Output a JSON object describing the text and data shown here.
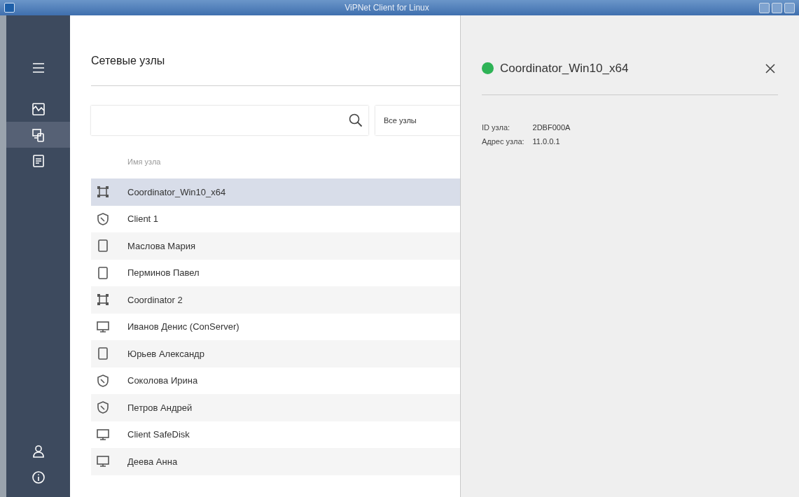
{
  "window": {
    "title": "ViPNet Client for Linux"
  },
  "sidebar": {
    "items": [
      {
        "kind": "map",
        "selected": false
      },
      {
        "kind": "nodes",
        "selected": true
      },
      {
        "kind": "log",
        "selected": false
      }
    ],
    "bottom": [
      {
        "kind": "user"
      },
      {
        "kind": "info"
      }
    ]
  },
  "list_panel": {
    "title": "Сетевые узлы",
    "filter": "Все узлы",
    "column": "Имя узла",
    "rows": [
      {
        "kind": "coordinator",
        "name": "Coordinator_Win10_x64",
        "selected": true
      },
      {
        "kind": "client",
        "name": "Client 1",
        "selected": false
      },
      {
        "kind": "mobile",
        "name": "Маслова Мария",
        "selected": false
      },
      {
        "kind": "mobile",
        "name": "Перминов Павел",
        "selected": false
      },
      {
        "kind": "coordinator",
        "name": "Coordinator 2",
        "selected": false
      },
      {
        "kind": "computer",
        "name": "Иванов Денис (ConServer)",
        "selected": false
      },
      {
        "kind": "mobile",
        "name": "Юрьев Александр",
        "selected": false
      },
      {
        "kind": "client",
        "name": "Соколова Ирина",
        "selected": false
      },
      {
        "kind": "client",
        "name": "Петров Андрей",
        "selected": false
      },
      {
        "kind": "computer",
        "name": "Client SafeDisk",
        "selected": false
      },
      {
        "kind": "computer",
        "name": "Деева Анна",
        "selected": false
      }
    ]
  },
  "detail": {
    "name": "Coordinator_Win10_x64",
    "color": "#2eb356",
    "fields": [
      {
        "label": "ID узла:",
        "value": "2DBF000A"
      },
      {
        "label": "Адрес узла:",
        "value": "11.0.0.1"
      }
    ]
  }
}
